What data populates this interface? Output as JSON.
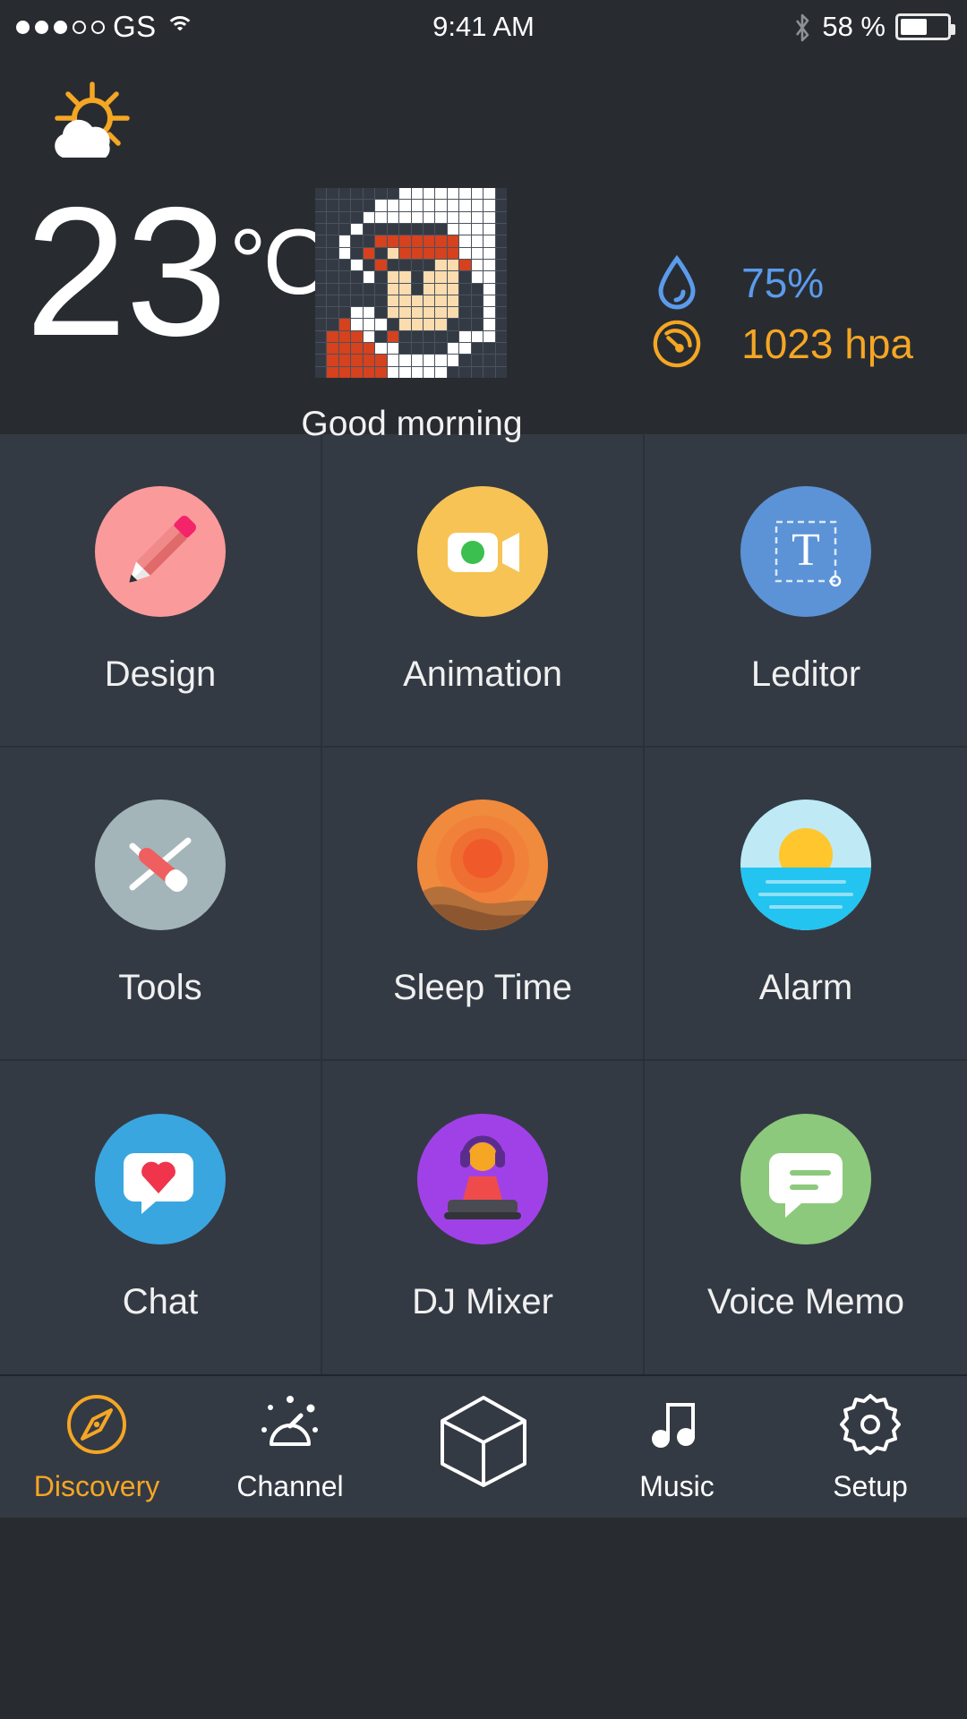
{
  "statusbar": {
    "signal_dots_filled": 3,
    "signal_dots_total": 5,
    "carrier": "GS",
    "wifi_icon": "wifi-icon",
    "time": "9:41 AM",
    "bluetooth_icon": "bluetooth-icon",
    "battery_percent": "58 %",
    "battery_level": 58
  },
  "weather": {
    "condition_icon": "sun-behind-cloud-icon",
    "temperature": "23",
    "unit": "°C",
    "greeting": "Good morning",
    "avatar_alt": "pixel-art-avatar",
    "stats": [
      {
        "icon": "water-drop-icon",
        "value": "75%",
        "color": "#5b9bec",
        "name": "humidity"
      },
      {
        "icon": "gauge-icon",
        "value": "1023 hpa",
        "color": "#f5a623",
        "name": "pressure"
      }
    ]
  },
  "apps": [
    {
      "label": "Design",
      "icon": "pencil-icon",
      "bg": "#fb9a9a"
    },
    {
      "label": "Animation",
      "icon": "video-camera-icon",
      "bg": "#f7c354"
    },
    {
      "label": "Leditor",
      "icon": "text-tool-icon",
      "bg": "#5b93d6"
    },
    {
      "label": "Tools",
      "icon": "swiss-knife-icon",
      "bg": "#a3b5b8"
    },
    {
      "label": "Sleep Time",
      "icon": "sunset-dunes-icon",
      "bg": "#f2803c"
    },
    {
      "label": "Alarm",
      "icon": "sunrise-sea-icon",
      "bg": "#37c6f0"
    },
    {
      "label": "Chat",
      "icon": "heart-bubble-icon",
      "bg": "#3aa6e0"
    },
    {
      "label": "DJ Mixer",
      "icon": "dj-icon",
      "bg": "#a041e8"
    },
    {
      "label": "Voice Memo",
      "icon": "speech-bubble-icon",
      "bg": "#8cc97c"
    }
  ],
  "tabs": [
    {
      "label": "Discovery",
      "icon": "compass-icon",
      "active": true
    },
    {
      "label": "Channel",
      "icon": "radar-dome-icon",
      "active": false
    },
    {
      "label": "",
      "icon": "cube-icon",
      "active": false
    },
    {
      "label": "Music",
      "icon": "music-note-icon",
      "active": false
    },
    {
      "label": "Setup",
      "icon": "gear-icon",
      "active": false
    }
  ],
  "colors": {
    "background": "#282c31",
    "cell": "#343a44",
    "accent": "#f5a623",
    "humidity": "#5b9bec"
  }
}
